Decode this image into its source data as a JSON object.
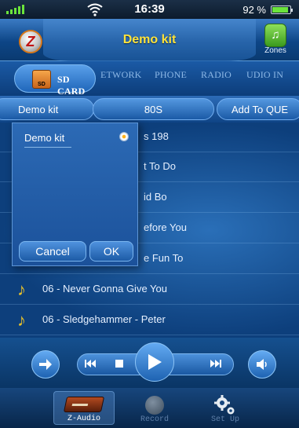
{
  "status_bar": {
    "time": "16:39",
    "battery_percent": "92 %",
    "battery_level": 0.92,
    "signal_icon": "signal-bars-icon",
    "wifi_icon": "wifi-icon"
  },
  "header": {
    "title": "Demo kit",
    "zones_label": "Zones",
    "logo_letter": "Z"
  },
  "tabs": [
    {
      "label": "SD CARD",
      "active": true
    },
    {
      "label": "ETWORK"
    },
    {
      "label": "PHONE"
    },
    {
      "label": "RADIO"
    },
    {
      "label": "UDIO IN"
    }
  ],
  "sd_icon_text": "SD",
  "breadcrumbs": {
    "root": "Demo kit",
    "folder": "80S",
    "action": "Add To QUE"
  },
  "tracks": [
    "s 198",
    "t To Do",
    "id Bo",
    "efore You",
    "e Fun To",
    "06 - Never Gonna Give You",
    "06 - Sledgehammer - Peter"
  ],
  "popup": {
    "option_label": "Demo kit",
    "cancel_label": "Cancel",
    "ok_label": "OK"
  },
  "bottom_tabs": [
    {
      "label": "Z-Audio"
    },
    {
      "label": "Record"
    },
    {
      "label": "Set Up"
    }
  ],
  "colors": {
    "accent_yellow": "#ffe33a",
    "background": "#0b3a6e",
    "note_gold": "#e8c02a"
  }
}
